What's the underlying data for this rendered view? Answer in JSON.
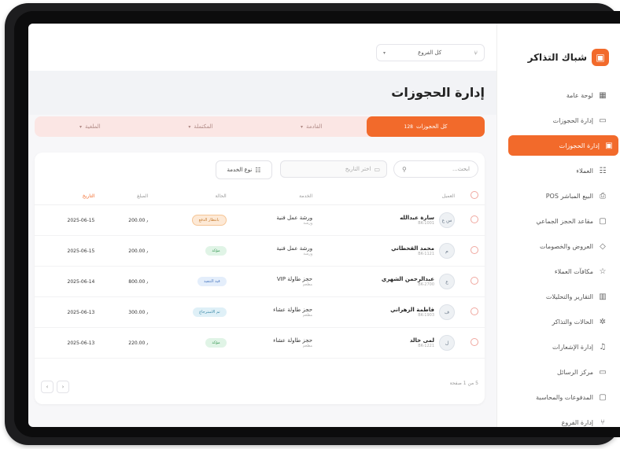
{
  "brand": {
    "name": "شباك التذاكر",
    "logo_icon": "ticket-icon"
  },
  "sidebar": {
    "items": [
      {
        "label": "لوحة عامة",
        "icon": "grid-icon",
        "glyph": "▦",
        "active": false
      },
      {
        "label": "إدارة الحجوزات",
        "icon": "calendar-icon",
        "glyph": "▭",
        "active": false
      },
      {
        "label": "إدارة الحجوزات",
        "icon": "calendar-check-icon",
        "glyph": "▣",
        "active": true
      },
      {
        "label": "العملاء",
        "icon": "users-icon",
        "glyph": "☷",
        "active": false
      },
      {
        "label": "البيع المباشر POS",
        "icon": "printer-icon",
        "glyph": "⎙",
        "active": false
      },
      {
        "label": "مقاعد الحجز الجماعي",
        "icon": "seat-icon",
        "glyph": "▢",
        "active": false
      },
      {
        "label": "العروض والخصومات",
        "icon": "tag-icon",
        "glyph": "◇",
        "active": false
      },
      {
        "label": "مكافآت العملاء",
        "icon": "star-icon",
        "glyph": "☆",
        "active": false
      },
      {
        "label": "التقارير والتحليلات",
        "icon": "chart-icon",
        "glyph": "▥",
        "active": false
      },
      {
        "label": "الحالات والتذاكر",
        "icon": "gear-icon",
        "glyph": "✲",
        "active": false
      },
      {
        "label": "إدارة الإشعارات",
        "icon": "bell-icon",
        "glyph": "♫",
        "active": false
      },
      {
        "label": "مركز الرسائل",
        "icon": "message-icon",
        "glyph": "▭",
        "active": false
      },
      {
        "label": "المدفوعات والمحاسبة",
        "icon": "wallet-icon",
        "glyph": "▢",
        "active": false
      },
      {
        "label": "إدارة الفروع",
        "icon": "branch-icon",
        "glyph": "⑂",
        "active": false
      }
    ]
  },
  "topbar": {
    "branch_select": "كل الفروع",
    "branch_icon": "branch-icon",
    "chevron_icon": "chevron-down-icon"
  },
  "page": {
    "title": "إدارة الحجوزات"
  },
  "tabs": [
    {
      "label": "كل الحجوزات",
      "count": "128",
      "active": true
    },
    {
      "label": "القادمة",
      "count": "",
      "active": false
    },
    {
      "label": "المكتملة",
      "count": "",
      "active": false
    },
    {
      "label": "الملغية",
      "count": "",
      "active": false
    }
  ],
  "filters": {
    "search_placeholder": "ابحث...",
    "date_placeholder": "اختر التاريخ",
    "type_label": "نوع الخدمة"
  },
  "table": {
    "headers": [
      "العميل",
      "الخدمة",
      "الحالة",
      "المبلغ",
      "التاريخ"
    ],
    "rows": [
      {
        "initials": "س ع",
        "name": "سارة عبدالله",
        "code": "BK-1001",
        "service": "ورشة عمل فنية",
        "service_sub": "ورشة",
        "status": "بانتظار الدفع",
        "status_color": "orange",
        "amount": "٫ 200.00",
        "date": "2025-06-15"
      },
      {
        "initials": "م",
        "name": "محمد القحطاني",
        "code": "BK-1121",
        "service": "ورشة عمل فنية",
        "service_sub": "ورشة",
        "status": "مؤكد",
        "status_color": "green",
        "amount": "٫ 200.00",
        "date": "2025-06-15"
      },
      {
        "initials": "ع",
        "name": "عبدالرحمن الشهري",
        "code": "BK-2700",
        "service": "حجز طاولة VIP",
        "service_sub": "مطعم",
        "status": "قيد التنفيذ",
        "status_color": "blue",
        "amount": "٫ 800.00",
        "date": "2025-06-14"
      },
      {
        "initials": "ف",
        "name": "فاطمة الزهراني",
        "code": "BK-1903",
        "service": "حجز طاولة عشاء",
        "service_sub": "مطعم",
        "status": "تم الاسترجاع",
        "status_color": "teal",
        "amount": "٫ 300.00",
        "date": "2025-06-13"
      },
      {
        "initials": "ل",
        "name": "لمى خالد",
        "code": "BK-1221",
        "service": "حجز طاولة عشاء",
        "service_sub": "مطعم",
        "status": "مؤكد",
        "status_color": "green",
        "amount": "٫ 220.00",
        "date": "2025-06-13"
      }
    ]
  },
  "footer": {
    "summary": "5 من 1 صفحة",
    "prev": "‹",
    "next": "›"
  },
  "colors": {
    "accent": "#f26a2b",
    "bg": "#f7f7f9"
  }
}
